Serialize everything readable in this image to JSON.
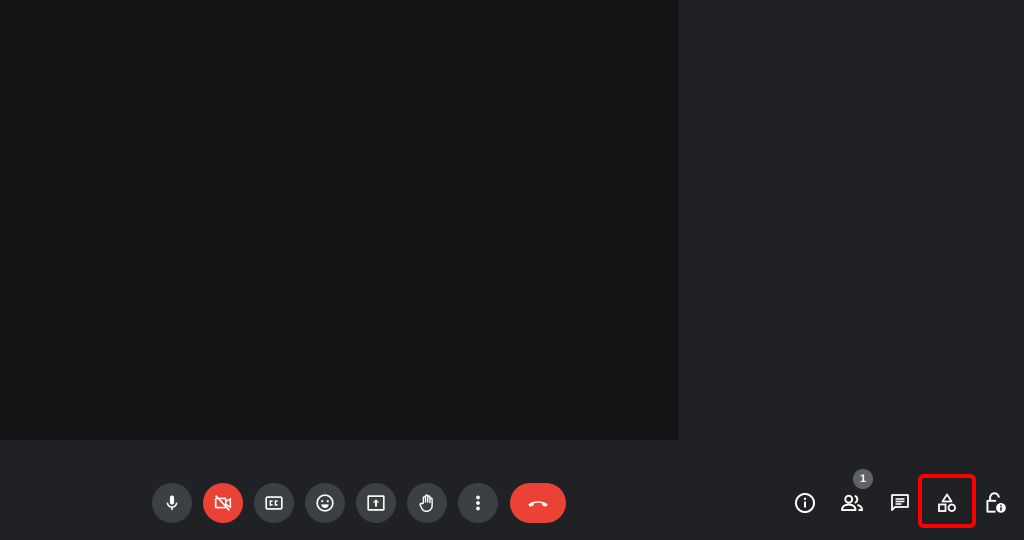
{
  "meeting": {
    "participant_count": "1"
  },
  "controls": {
    "microphone": {
      "icon": "microphone-icon",
      "state": "on"
    },
    "camera": {
      "icon": "camera-off-icon",
      "state": "off"
    },
    "captions": {
      "icon": "closed-captions-icon"
    },
    "reactions": {
      "icon": "emoji-icon"
    },
    "present": {
      "icon": "present-screen-icon"
    },
    "raise_hand": {
      "icon": "raise-hand-icon"
    },
    "more_options": {
      "icon": "more-vertical-icon"
    },
    "leave_call": {
      "icon": "hang-up-icon"
    }
  },
  "side_controls": {
    "details": {
      "icon": "info-icon"
    },
    "people": {
      "icon": "people-icon"
    },
    "chat": {
      "icon": "chat-icon"
    },
    "activities": {
      "icon": "activities-shapes-icon",
      "highlighted": true
    },
    "host_controls": {
      "icon": "host-lock-icon"
    }
  },
  "colors": {
    "background": "#202124",
    "video_tile": "#131416",
    "button": "#3c4043",
    "danger": "#ea4335",
    "highlight": "#ff0000",
    "icon": "#ffffff",
    "badge": "#5f6368"
  }
}
